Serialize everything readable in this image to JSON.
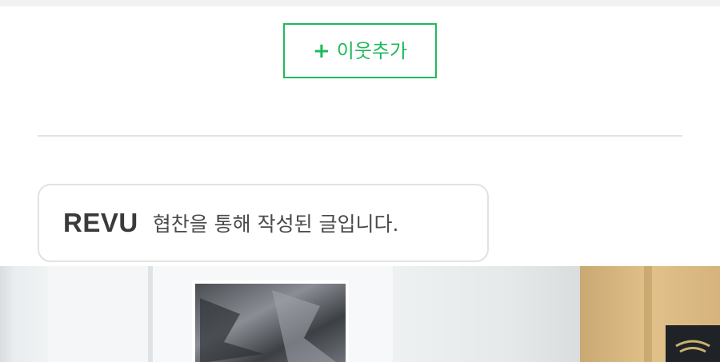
{
  "neighbor_button": {
    "plus_symbol": "+",
    "label": "이웃추가"
  },
  "sponsor_badge": {
    "logo_text": "REVU",
    "notice_text": "협찬을 통해 작성된 글입니다."
  },
  "colors": {
    "accent_green": "#1fb95a",
    "divider_gray": "#e3e3e3",
    "badge_border": "#e2e2e2"
  },
  "icons": {
    "add": "plus-icon"
  }
}
